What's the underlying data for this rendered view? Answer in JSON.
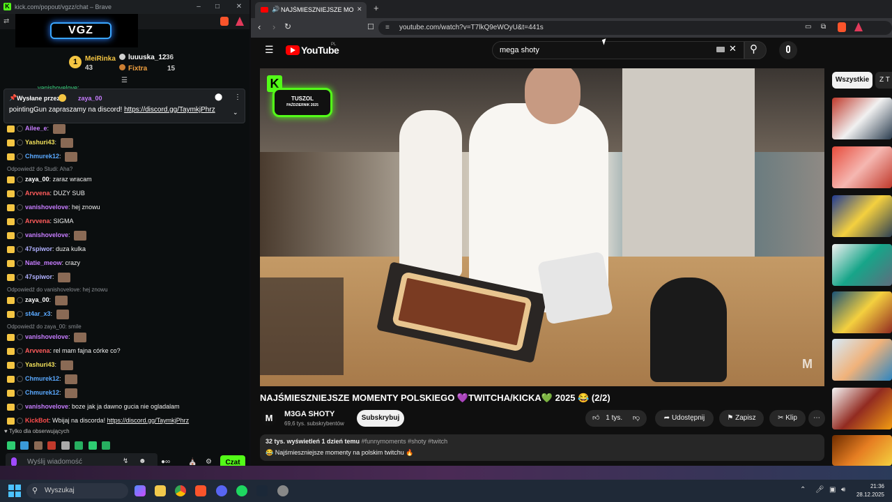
{
  "kick": {
    "window_title": "kick.com/popout/vgzz/chat – Brave",
    "channel_logo": "VGZ",
    "leaders": [
      {
        "name": "MeiRinka",
        "count": "43",
        "rank": "1"
      },
      {
        "name": "luuuska_12",
        "count": "36"
      },
      {
        "name": "Fixtra",
        "count": "15"
      }
    ],
    "top_partial_user": "vanishovelove:",
    "pinned": {
      "label": "Wysłane przez",
      "author": "zaya_00",
      "message": "pointingGun zapraszamy na discord! ",
      "link": "https://discord.gg/TaymkjPhrz"
    },
    "messages": [
      {
        "user": "Ailee_e",
        "text": "",
        "color": "#c77dff"
      },
      {
        "user": "Yashuri43",
        "text": "",
        "color": "#f1e05a"
      },
      {
        "user": "Chmurek12",
        "text": "",
        "color": "#5aa9ff"
      },
      {
        "reply": "Odpowiedź do Studi: Aha?"
      },
      {
        "user": "zaya_00",
        "text": "zaraz wracam",
        "color": "#ffffff"
      },
      {
        "user": "Arvvena",
        "text": "DUZY SUB",
        "color": "#ff5c5c"
      },
      {
        "user": "vanishovelove",
        "text": "hej znowu",
        "color": "#c77dff"
      },
      {
        "user": "Arvvena",
        "text": "SIGMA",
        "color": "#ff5c5c"
      },
      {
        "user": "vanishovelove",
        "text": "",
        "color": "#c77dff"
      },
      {
        "user": "47spiwor",
        "text": "duza kulka",
        "color": "#b0b0ff"
      },
      {
        "user": "Natie_meow",
        "text": "crazy",
        "color": "#c77dff"
      },
      {
        "user": "47spiwor",
        "text": "",
        "color": "#b0b0ff"
      },
      {
        "reply": "Odpowiedź do vanishovelove: hej znowu"
      },
      {
        "user": "zaya_00",
        "text": "",
        "color": "#ffffff"
      },
      {
        "user": "st4ar_x3",
        "text": "",
        "color": "#5aa9ff"
      },
      {
        "reply": "Odpowiedź do zaya_00: smile"
      },
      {
        "user": "vanishovelove",
        "text": "",
        "color": "#c77dff"
      },
      {
        "user": "Arvvena",
        "text": "rel mam fajna córke co?",
        "color": "#ff5c5c"
      },
      {
        "user": "Yashuri43",
        "text": "",
        "color": "#f1e05a"
      },
      {
        "user": "Chmurek12",
        "text": "",
        "color": "#5aa9ff"
      },
      {
        "user": "Chmurek12",
        "text": "",
        "color": "#5aa9ff"
      },
      {
        "user": "vanishovelove",
        "text": "boze jak ja dawno gucia nie ogladalam",
        "color": "#c77dff"
      },
      {
        "user": "KickBot",
        "text": "Wbijaj na discorda! ",
        "link": "https://discord.gg/TaymkjPhrz",
        "color": "#ff4d4d"
      }
    ],
    "followers_only": "Tylko dla obserwujących",
    "input_placeholder": "Wyślij wiadomość",
    "send_label": "Czat"
  },
  "browser": {
    "tab_title": "NAJŚMIESZNIEJSZE MOMENTY",
    "url": "youtube.com/watch?v=T7lkQ9eWOyU&t=441s",
    "search_value": "mega shoty",
    "yt_logo": "YouTube",
    "yt_region": "PL",
    "overlay_badge_line1": "TUSZOL",
    "overlay_badge_line2": "PAŹDZIERNIK 2025",
    "video_title": "NAJŚMIESZNIEJSZE MOMENTY POLSKIEGO 💜TWITCHA/KICKA💚 2025 😂 (2/2)",
    "channel": {
      "name": "M3GA SHOTY",
      "subs": "69,6 tys. subskrybentów",
      "avatar": "M"
    },
    "subscribe": "Subskrybuj",
    "likes": "1 tys.",
    "share": "Udostępnij",
    "save": "Zapisz",
    "clip": "Klip",
    "views": "32 tys. wyświetleń  1 dzień temu",
    "hashtags": "#funnymoments #shoty #twitch",
    "description": "😂 Najśmieszniejsze momenty na polskim twitchu 🔥",
    "filters": [
      "Wszystkie",
      "Z T"
    ]
  },
  "taskbar": {
    "search": "Wyszukaj",
    "time": "21:36",
    "date": "28.12.2025"
  }
}
